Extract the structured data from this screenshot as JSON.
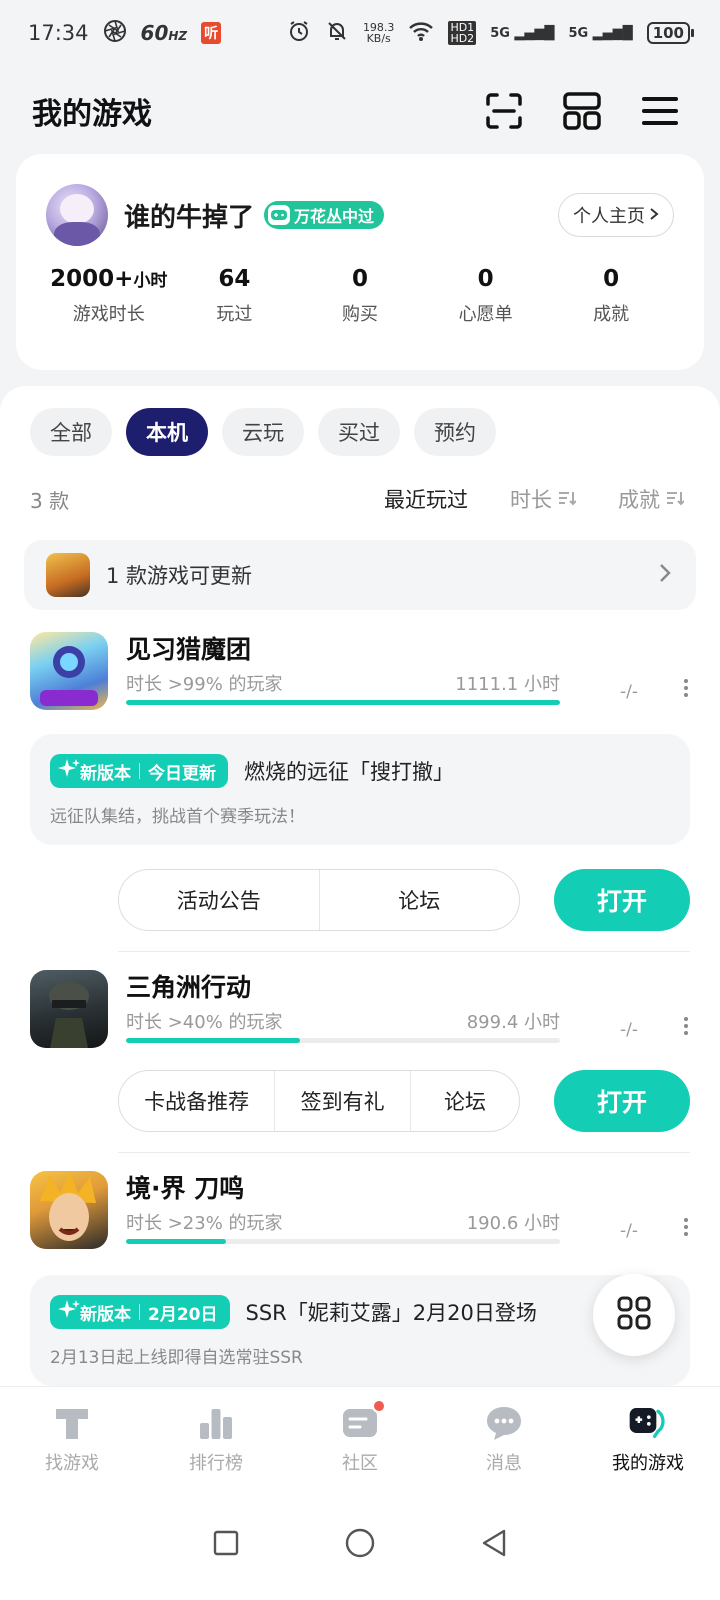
{
  "status_bar": {
    "time": "17:34",
    "refresh_rate": "60",
    "refresh_unit": "HZ",
    "app_badge": "听",
    "net_speed_value": "198.3",
    "net_speed_unit": "KB/s",
    "hd1": "HD1",
    "hd2": "HD2",
    "sim1": "5G",
    "sim2": "5G",
    "battery": "100"
  },
  "header": {
    "title": "我的游戏"
  },
  "profile": {
    "username": "谁的牛掉了",
    "badge": "万花丛中过",
    "homepage_btn": "个人主页",
    "stats": [
      {
        "value": "2000+",
        "unit": "小时",
        "label": "游戏时长"
      },
      {
        "value": "64",
        "unit": "",
        "label": "玩过"
      },
      {
        "value": "0",
        "unit": "",
        "label": "购买"
      },
      {
        "value": "0",
        "unit": "",
        "label": "心愿单"
      },
      {
        "value": "0",
        "unit": "",
        "label": "成就"
      }
    ]
  },
  "filters": {
    "tabs": [
      "全部",
      "本机",
      "云玩",
      "买过",
      "预约"
    ],
    "active_index": 1
  },
  "sort": {
    "count": "3 款",
    "options": [
      "最近玩过",
      "时长",
      "成就"
    ]
  },
  "update_banner": {
    "text": "1 款游戏可更新"
  },
  "games": [
    {
      "name": "见习猎魔团",
      "rank_text": "时长 >99% 的玩家",
      "hours": "1111.1 小时",
      "progress": 1.0,
      "achievement": "-/-",
      "news": {
        "tag_left": "新版本",
        "tag_right": "今日更新",
        "title": "燃烧的远征「搜打撤」",
        "subtitle": "远征队集结，挑战首个赛季玩法！"
      },
      "actions": [
        "活动公告",
        "论坛"
      ],
      "open_label": "打开"
    },
    {
      "name": "三角洲行动",
      "rank_text": "时长 >40% 的玩家",
      "hours": "899.4 小时",
      "progress": 0.4,
      "achievement": "-/-",
      "actions": [
        "卡战备推荐",
        "签到有礼",
        "论坛"
      ],
      "open_label": "打开"
    },
    {
      "name": "境·界 刀鸣",
      "rank_text": "时长 >23% 的玩家",
      "hours": "190.6 小时",
      "progress": 0.23,
      "achievement": "-/-",
      "news": {
        "tag_left": "新版本",
        "tag_right": "2月20日",
        "title": "SSR「妮莉艾露」2月20日登场",
        "subtitle": "2月13日起上线即得自选常驻SSR"
      }
    }
  ],
  "bottom_nav": [
    {
      "label": "找游戏",
      "icon": "find-games-icon"
    },
    {
      "label": "排行榜",
      "icon": "ranking-icon"
    },
    {
      "label": "社区",
      "icon": "community-icon"
    },
    {
      "label": "消息",
      "icon": "message-icon"
    },
    {
      "label": "我的游戏",
      "icon": "my-games-icon"
    }
  ],
  "colors": {
    "accent": "#13cdb5",
    "active_tab": "#1d1f6e",
    "badge": "#22c49a",
    "notification": "#f05a4f"
  }
}
